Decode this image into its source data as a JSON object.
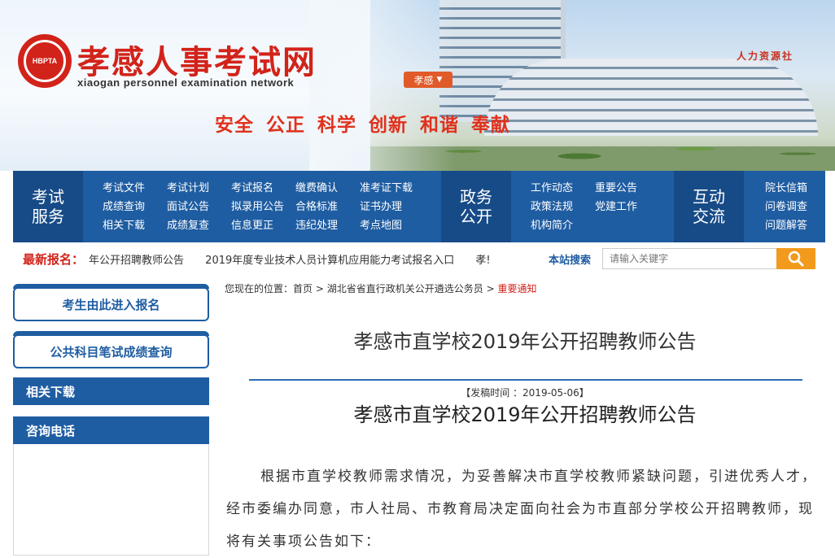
{
  "header": {
    "logo_text": "HBPTA",
    "site_title": "孝感人事考试网",
    "site_subtitle": "xiaogan personnel examination network",
    "city_selector": "孝感",
    "slogan": "安全 公正 科学 创新 和谐 奉献",
    "building_sign": "人力资源社"
  },
  "nav": {
    "groups": [
      {
        "title": "考试服务",
        "items": [
          "考试文件",
          "考试计划",
          "考试报名",
          "缴费确认",
          "准考证下载",
          "成绩查询",
          "面试公告",
          "拟录用公告",
          "合格标准",
          "证书办理",
          "相关下载",
          "成绩复查",
          "信息更正",
          "违纪处理",
          "考点地图"
        ]
      },
      {
        "title": "政务公开",
        "items": [
          "工作动态",
          "重要公告",
          "政策法规",
          "党建工作",
          "机构简介"
        ]
      },
      {
        "title": "互动交流",
        "items": [
          "院长信箱",
          "问卷调查",
          "问题解答"
        ]
      }
    ]
  },
  "ticker": {
    "label": "最新报名：",
    "items": [
      "年公开招聘教师公告",
      "2019年度专业技术人员计算机应用能力考试报名入口",
      "孝!"
    ]
  },
  "search": {
    "label": "本站搜索",
    "placeholder": "请输入关键字"
  },
  "sidebar": {
    "buttons": [
      "考生由此进入报名",
      "公共科目笔试成绩查询"
    ],
    "sections": [
      "相关下载",
      "咨询电话"
    ]
  },
  "breadcrumb": {
    "prefix": "您现在的位置：",
    "items": [
      "首页",
      "湖北省省直行政机关公开遴选公务员",
      "重要通知"
    ],
    "separator": ">"
  },
  "article": {
    "page_title": "孝感市直学校2019年公开招聘教师公告",
    "date_label": "【发稿时间 ：2019-05-06】",
    "title": "孝感市直学校2019年公开招聘教师公告",
    "body": "根据市直学校教师需求情况，为妥善解决市直学校教师紧缺问题，引进优秀人才，经市委编办同意，市人社局、市教育局决定面向社会为市直部分学校公开招聘教师，现将有关事项公告如下："
  },
  "colors": {
    "brand_red": "#d2231a",
    "nav_blue": "#1f5da2",
    "search_orange": "#f29a1c"
  }
}
